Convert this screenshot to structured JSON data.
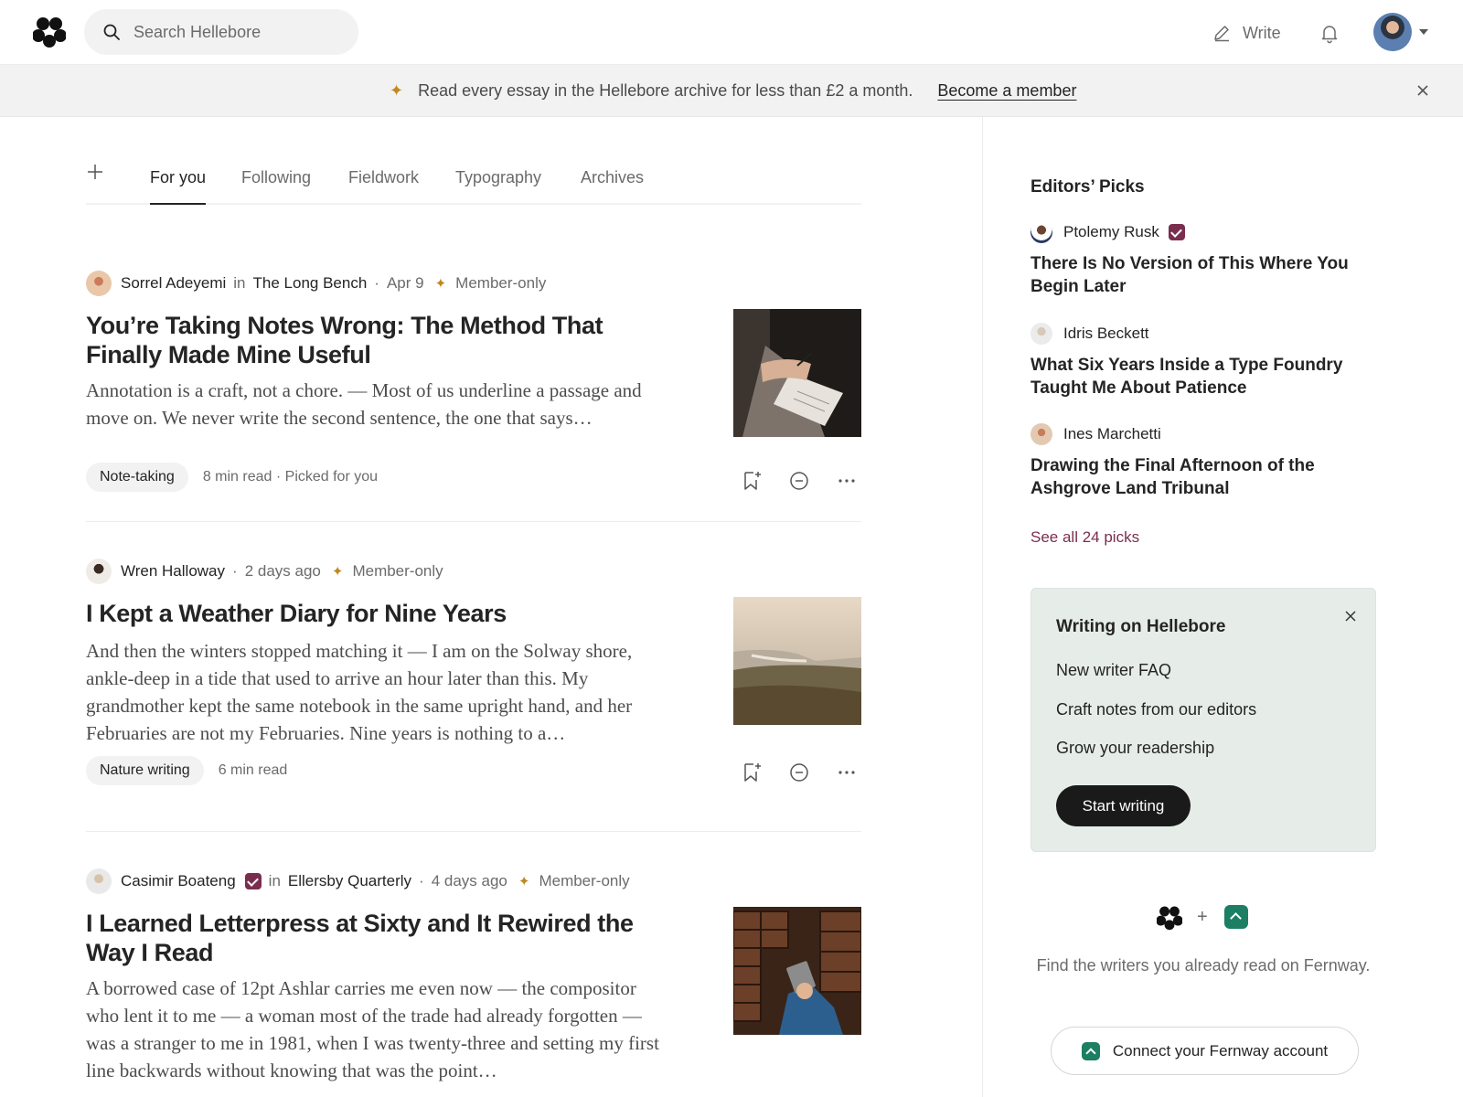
{
  "search": {
    "placeholder": "Search Hellebore"
  },
  "header": {
    "write_label": "Write"
  },
  "banner": {
    "text": "Read every essay in the Hellebore archive for less than £2 a month.",
    "cta": "Become a member"
  },
  "tabs": [
    "For you",
    "Following",
    "Fieldwork",
    "Typography",
    "Archives"
  ],
  "articles": [
    {
      "author": "Sorrel Adeyemi",
      "in": "in",
      "publication": "The Long Bench",
      "date": "Apr 9",
      "access": "Member-only",
      "title": "You’re Taking Notes Wrong: The Method That Finally Made Mine Useful",
      "excerpt": "Annotation is a craft, not a chore. — Most of us underline a passage and move on. We never write the second sentence, the one that says…",
      "tag": "Note-taking",
      "footer": "8 min read · Picked for you"
    },
    {
      "author": "Wren Halloway",
      "date": "2 days ago",
      "access": "Member-only",
      "title": "I Kept a Weather Diary for Nine Years",
      "excerpt": "And then the winters stopped matching it — I am on the Solway shore, ankle-deep in a tide that used to arrive an hour later than this. My grandmother kept the same notebook in the same upright hand, and her Februaries are not my Februaries. Nine years is nothing to a…",
      "tag": "Nature writing",
      "footer": "6 min read"
    },
    {
      "author": "Casimir Boateng",
      "in": "in",
      "publication": "Ellersby Quarterly",
      "date": "4 days ago",
      "access": "Member-only",
      "title": "I Learned Letterpress at Sixty and It Rewired the Way I Read",
      "excerpt": "A borrowed case of 12pt Ashlar carries me even now — the compositor who lent it to me — a woman most of the trade had already forgotten — was a stranger to me in 1981, when I was twenty-three and setting my first line backwards without knowing that was the point…"
    }
  ],
  "sidebar": {
    "heading": "Editors’ Picks",
    "picks": [
      {
        "author": "Ptolemy Rusk",
        "title": "There Is No Version of This Where You Begin Later"
      },
      {
        "author": "Idris Beckett",
        "title": "What Six Years Inside a Type Foundry Taught Me About Patience"
      },
      {
        "author": "Ines Marchetti",
        "title": "Drawing the Final Afternoon of the Ashgrove Land Tribunal"
      }
    ],
    "see_all": "See all 24 picks",
    "panel": {
      "heading": "Writing on Hellebore",
      "links": [
        "New writer FAQ",
        "Craft notes from our editors",
        "Grow your readership"
      ],
      "cta": "Start writing"
    },
    "connect": {
      "plus": "+",
      "text": "Find the writers you already read on Fernway.",
      "button": "Connect your Fernway account"
    }
  },
  "colors": {
    "accent": "#7a2e4f",
    "star": "#c0891f",
    "panel_bg": "#e6ede9",
    "fernway": "#1c7e63"
  }
}
